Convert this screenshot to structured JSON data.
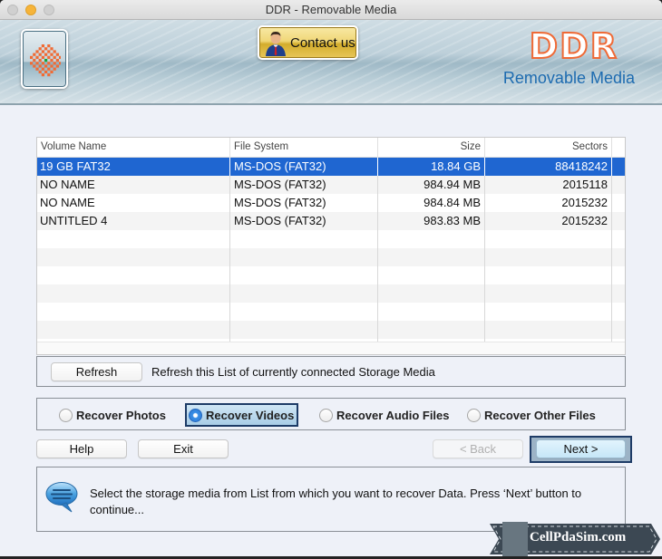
{
  "window": {
    "title": "DDR - Removable Media",
    "traffic_lights": [
      "close",
      "minimize",
      "zoom"
    ]
  },
  "banner": {
    "logo_icon": "checker-burst-logo-icon",
    "contact_button": {
      "label": "Contact us",
      "icon": "person-icon"
    },
    "brand_title": "DDR",
    "brand_subtitle": "Removable Media",
    "colors": {
      "brand_title": "#ef6a36",
      "brand_subtitle": "#1d6bb0"
    }
  },
  "table": {
    "columns": [
      "Volume Name",
      "File System",
      "Size",
      "Sectors"
    ],
    "rows": [
      {
        "volume": "19 GB  FAT32",
        "fs": "MS-DOS (FAT32)",
        "size": "18.84 GB",
        "sectors": "88418242",
        "selected": true
      },
      {
        "volume": "NO NAME",
        "fs": "MS-DOS (FAT32)",
        "size": "984.94  MB",
        "sectors": "2015118",
        "selected": false
      },
      {
        "volume": "NO NAME",
        "fs": "MS-DOS (FAT32)",
        "size": "984.84  MB",
        "sectors": "2015232",
        "selected": false
      },
      {
        "volume": "UNTITLED 4",
        "fs": "MS-DOS (FAT32)",
        "size": "983.83  MB",
        "sectors": "2015232",
        "selected": false
      }
    ],
    "selection_color": "#1f66d1"
  },
  "refresh": {
    "button_label": "Refresh",
    "description": "Refresh this List of currently connected Storage Media"
  },
  "recovery_options": {
    "selected": "Recover Videos",
    "options": [
      "Recover Photos",
      "Recover Videos",
      "Recover Audio Files",
      "Recover Other Files"
    ]
  },
  "actions": {
    "help": "Help",
    "exit": "Exit",
    "back": "< Back",
    "next": "Next >",
    "back_enabled": false
  },
  "info": {
    "icon": "speech-bubble-icon",
    "message": "Select the storage media from List from which you want to recover Data. Press ‘Next’ button to continue..."
  },
  "watermark": {
    "text": "CellPdaSim.com"
  }
}
